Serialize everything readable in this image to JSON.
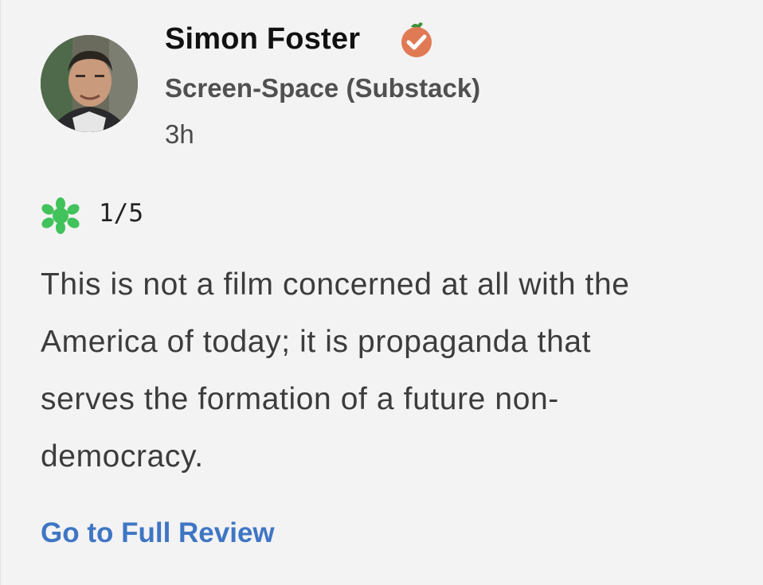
{
  "review": {
    "critic_name": "Simon Foster",
    "publication": "Screen-Space (Substack)",
    "timestamp": "3h",
    "score": "1/5",
    "text_lines": [
      "This is not a film concerned at all with the",
      "America of today; it is propaganda that",
      "serves the formation of a future non-",
      "democracy."
    ],
    "link_label": "Go to Full Review"
  },
  "icons": {
    "verified": "verified-critic-icon",
    "splat": "rotten-splat-icon",
    "avatar": "critic-avatar"
  },
  "colors": {
    "card_background": "#f3f3f4",
    "verified_badge": "#e07a55",
    "splat_green": "#41c25a",
    "link": "#3f76c4"
  }
}
